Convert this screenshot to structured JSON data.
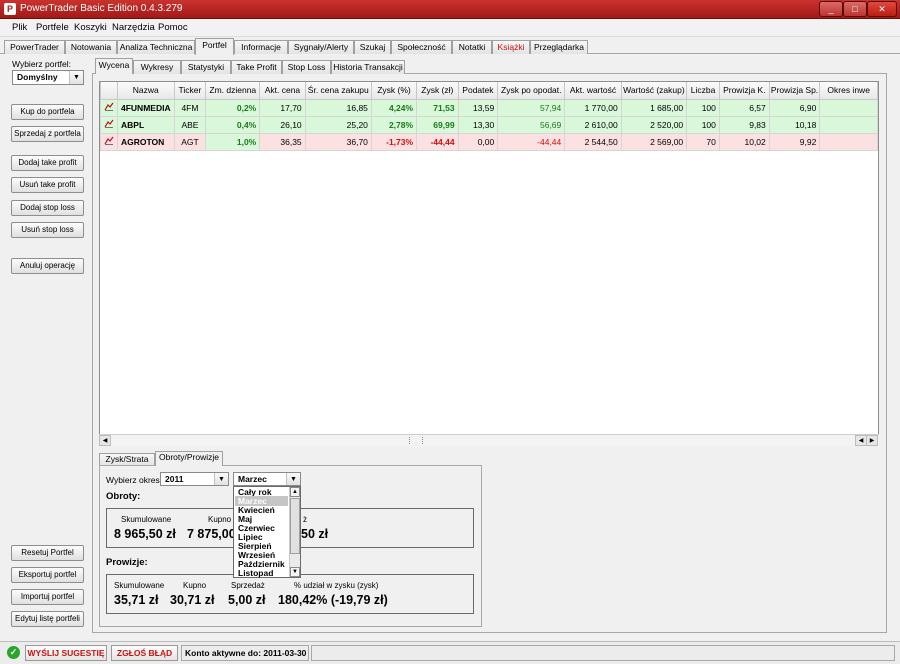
{
  "window": {
    "title": "PowerTrader Basic Edition 0.4.3.279",
    "minimize": "_",
    "maximize": "□",
    "close": "✕"
  },
  "menu": [
    "Plik",
    "Portfele",
    "Koszyki",
    "Narzędzia",
    "Pomoc"
  ],
  "main_tabs": [
    "PowerTrader",
    "Notowania",
    "Analiza Techniczna",
    "Portfel",
    "Informacje",
    "Sygnały/Alerty",
    "Szukaj",
    "Społeczność",
    "Notatki",
    "Książki",
    "Przeglądarka"
  ],
  "left": {
    "select_label": "Wybierz portfel:",
    "selected": "Domyślny",
    "buttons_top": [
      "Kup do portfela",
      "Sprzedaj z portfela"
    ],
    "buttons_mid": [
      "Dodaj take profit",
      "Usuń take profit",
      "Dodaj stop loss",
      "Usuń stop loss"
    ],
    "cancel_btn": "Anuluj operację",
    "buttons_bottom": [
      "Resetuj Portfel",
      "Eksportuj portfel",
      "Importuj portfel",
      "Edytuj listę portfeli"
    ]
  },
  "sub_tabs": [
    "Wycena",
    "Wykresy",
    "Statystyki",
    "Take Profit",
    "Stop Loss",
    "Historia Transakcji"
  ],
  "table": {
    "headers": [
      "Nazwa",
      "Ticker",
      "Zm. dzienna",
      "Akt. cena",
      "Śr. cena zakupu",
      "Zysk (%)",
      "Zysk (zł)",
      "Podatek",
      "Zysk po opodat.",
      "Akt. wartość",
      "Wartość (zakup)",
      "Liczba",
      "Prowizja K.",
      "Prowizja Sp.",
      "Okres inwe"
    ],
    "rows": [
      [
        "4FUNMEDIA",
        "4FM",
        "0,2%",
        "17,70",
        "16,85",
        "4,24%",
        "71,53",
        "13,59",
        "57,94",
        "1 770,00",
        "1 685,00",
        "100",
        "6,57",
        "6,90",
        ""
      ],
      [
        "ABPL",
        "ABE",
        "0,4%",
        "26,10",
        "25,20",
        "2,78%",
        "69,99",
        "13,30",
        "56,69",
        "2 610,00",
        "2 520,00",
        "100",
        "9,83",
        "10,18",
        ""
      ],
      [
        "AGROTON",
        "AGT",
        "1,0%",
        "36,35",
        "36,70",
        "-1,73%",
        "-44,44",
        "0,00",
        "-44,44",
        "2 544,50",
        "2 569,00",
        "70",
        "10,02",
        "9,92",
        ""
      ]
    ]
  },
  "bottom_tabs": [
    "Zysk/Strata",
    "Obroty/Prowizje"
  ],
  "period": {
    "label": "Wybierz okres:",
    "year": "2011",
    "month": "Marzec"
  },
  "dropdown_items": [
    "Cały rok",
    "Marzec",
    "Kwiecień",
    "Maj",
    "Czerwiec",
    "Lipiec",
    "Sierpień",
    "Wrzesień",
    "Październik",
    "Listopad"
  ],
  "obroty": {
    "title": "Obroty:",
    "cum_label": "Skumulowane",
    "cum_value": "8 965,50 zł",
    "buy_label": "Kupno",
    "buy_value": "7 875,00",
    "sell_label_tail": "ż",
    "sell_value_tail": "50 zł"
  },
  "prowizje": {
    "title": "Prowizje:",
    "cum_label": "Skumulowane",
    "cum_value": "35,71 zł",
    "buy_label": "Kupno",
    "buy_value": "30,71 zł",
    "sell_label": "Sprzedaż",
    "sell_value": "5,00 zł",
    "share_label": "% udział w zysku (zysk)",
    "share_value": "180,42% (-19,79 zł)"
  },
  "status": {
    "suggest": "WYŚLIJ SUGESTIĘ",
    "report": "ZGŁOŚ BŁĄD",
    "account": "Konto aktywne do: 2011-03-30"
  }
}
